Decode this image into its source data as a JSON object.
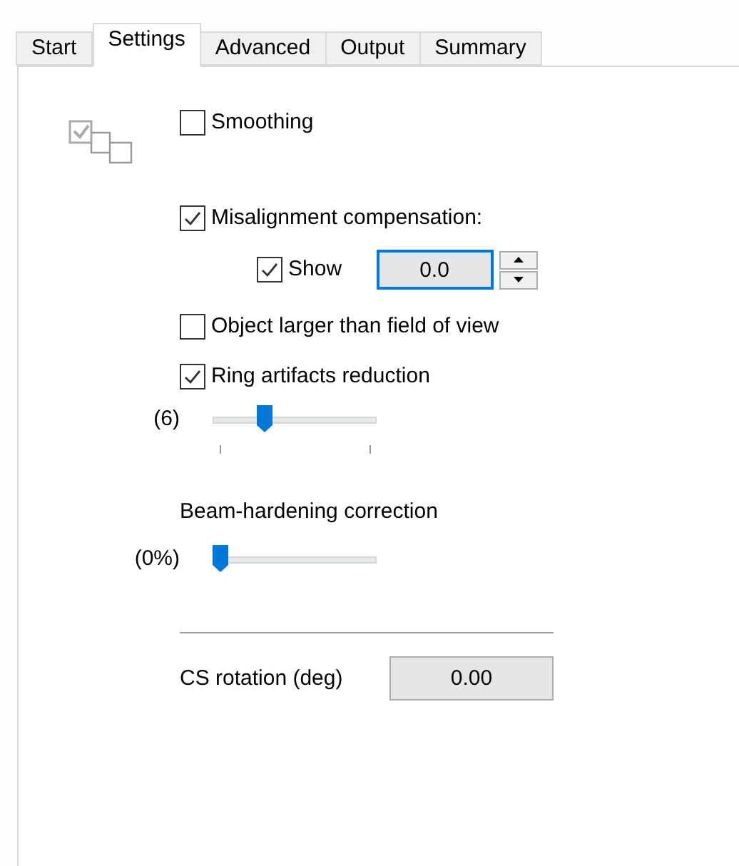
{
  "tabs": [
    {
      "label": "Start",
      "selected": false
    },
    {
      "label": "Settings",
      "selected": true
    },
    {
      "label": "Advanced",
      "selected": false
    },
    {
      "label": "Output",
      "selected": false
    },
    {
      "label": "Summary",
      "selected": false
    }
  ],
  "smoothing": {
    "label": "Smoothing",
    "checked": false
  },
  "misalignment": {
    "label": "Misalignment compensation:",
    "checked": true
  },
  "show": {
    "label": "Show",
    "checked": true,
    "value": "0.0",
    "focused": true
  },
  "object_larger": {
    "label": "Object larger than field of view",
    "checked": false
  },
  "ring_artifacts": {
    "label": "Ring artifacts reduction",
    "checked": true
  },
  "ring_slider": {
    "reading": "(6)",
    "level": 0.3,
    "ticks": true
  },
  "beam_hardening": {
    "label": "Beam-hardening correction"
  },
  "beam_slider": {
    "reading": "(0%)",
    "level": 0
  },
  "cs_rotation": {
    "label": "CS rotation (deg)",
    "value": "0.00"
  }
}
